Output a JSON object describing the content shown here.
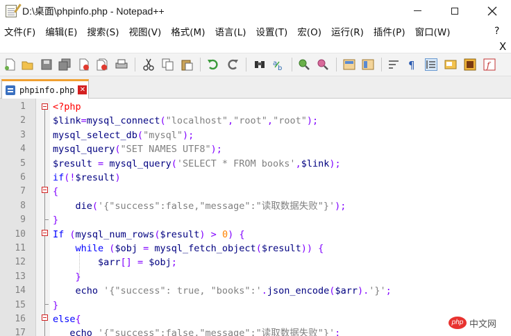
{
  "window": {
    "title": "D:\\桌面\\phpinfo.php - Notepad++"
  },
  "menu": {
    "items": [
      "文件(F)",
      "编辑(E)",
      "搜索(S)",
      "视图(V)",
      "格式(M)",
      "语言(L)",
      "设置(T)",
      "宏(O)",
      "运行(R)",
      "插件(P)",
      "窗口(W)"
    ],
    "help": "?",
    "doc_close": "X"
  },
  "toolbar": {
    "icons": [
      "new-file-icon",
      "open-file-icon",
      "save-icon",
      "save-all-icon",
      "close-file-icon",
      "close-all-icon",
      "print-icon",
      "cut-icon",
      "copy-icon",
      "paste-icon",
      "undo-icon",
      "redo-icon",
      "find-icon",
      "replace-icon",
      "zoom-in-icon",
      "zoom-out-icon",
      "sync-vertical-icon",
      "sync-horizontal-icon",
      "word-wrap-icon",
      "show-all-chars-icon",
      "indent-guide-icon",
      "user-lang-icon",
      "doc-map-icon",
      "function-list-icon"
    ]
  },
  "tab": {
    "label": "phpinfo.php"
  },
  "editor": {
    "line_numbers": [
      "1",
      "2",
      "3",
      "4",
      "5",
      "6",
      "7",
      "8",
      "9",
      "10",
      "11",
      "12",
      "13",
      "14",
      "15",
      "16",
      "17"
    ],
    "lines": [
      [
        [
          "php",
          "<?php"
        ]
      ],
      [
        [
          "var",
          "$link"
        ],
        [
          "op",
          "="
        ],
        [
          "fn",
          "mysql_connect"
        ],
        [
          "op",
          "("
        ],
        [
          "str",
          "\"localhost\""
        ],
        [
          "op",
          ","
        ],
        [
          "str",
          "\"root\""
        ],
        [
          "op",
          ","
        ],
        [
          "str",
          "\"root\""
        ],
        [
          "op",
          ");"
        ]
      ],
      [
        [
          "fn",
          "mysql_select_db"
        ],
        [
          "op",
          "("
        ],
        [
          "str",
          "\"mysql\""
        ],
        [
          "op",
          ");"
        ]
      ],
      [
        [
          "fn",
          "mysql_query"
        ],
        [
          "op",
          "("
        ],
        [
          "str",
          "\"SET NAMES UTF8\""
        ],
        [
          "op",
          ");"
        ]
      ],
      [
        [
          "var",
          "$result"
        ],
        [
          "pl",
          " "
        ],
        [
          "op",
          "="
        ],
        [
          "pl",
          " "
        ],
        [
          "fn",
          "mysql_query"
        ],
        [
          "op",
          "("
        ],
        [
          "str",
          "'SELECT * FROM books'"
        ],
        [
          "op",
          ","
        ],
        [
          "var",
          "$link"
        ],
        [
          "op",
          ");"
        ]
      ],
      [
        [
          "kw",
          "if"
        ],
        [
          "op",
          "(!"
        ],
        [
          "var",
          "$result"
        ],
        [
          "op",
          ")"
        ]
      ],
      [
        [
          "op",
          "{"
        ]
      ],
      [
        [
          "pl",
          "    "
        ],
        [
          "fn",
          "die"
        ],
        [
          "op",
          "("
        ],
        [
          "str",
          "'{\"success\":false,\"message\":\"读取数据失败\"}'"
        ],
        [
          "op",
          ");"
        ]
      ],
      [
        [
          "op",
          "}"
        ]
      ],
      [
        [
          "kw",
          "If"
        ],
        [
          "pl",
          " "
        ],
        [
          "op",
          "("
        ],
        [
          "fn",
          "mysql_num_rows"
        ],
        [
          "op",
          "("
        ],
        [
          "var",
          "$result"
        ],
        [
          "op",
          ")"
        ],
        [
          "pl",
          " "
        ],
        [
          "op",
          ">"
        ],
        [
          "pl",
          " "
        ],
        [
          "num",
          "0"
        ],
        [
          "op",
          ")"
        ],
        [
          "pl",
          " "
        ],
        [
          "op",
          "{"
        ]
      ],
      [
        [
          "pl",
          "    "
        ],
        [
          "kw",
          "while"
        ],
        [
          "pl",
          " "
        ],
        [
          "op",
          "("
        ],
        [
          "var",
          "$obj"
        ],
        [
          "pl",
          " "
        ],
        [
          "op",
          "="
        ],
        [
          "pl",
          " "
        ],
        [
          "fn",
          "mysql_fetch_object"
        ],
        [
          "op",
          "("
        ],
        [
          "var",
          "$result"
        ],
        [
          "op",
          "))"
        ],
        [
          "pl",
          " "
        ],
        [
          "op",
          "{"
        ]
      ],
      [
        [
          "pl",
          "        "
        ],
        [
          "var",
          "$arr"
        ],
        [
          "op",
          "[]"
        ],
        [
          "pl",
          " "
        ],
        [
          "op",
          "="
        ],
        [
          "pl",
          " "
        ],
        [
          "var",
          "$obj"
        ],
        [
          "op",
          ";"
        ]
      ],
      [
        [
          "pl",
          "    "
        ],
        [
          "op",
          "}"
        ]
      ],
      [
        [
          "pl",
          "    "
        ],
        [
          "fn",
          "echo"
        ],
        [
          "pl",
          " "
        ],
        [
          "str",
          "'{\"success\": true, \"books\":'"
        ],
        [
          "op",
          "."
        ],
        [
          "fn",
          "json_encode"
        ],
        [
          "op",
          "("
        ],
        [
          "var",
          "$arr"
        ],
        [
          "op",
          ")."
        ],
        [
          "str",
          "'}'"
        ],
        [
          "op",
          ";"
        ]
      ],
      [
        [
          "op",
          "}"
        ]
      ],
      [
        [
          "kw",
          "else"
        ],
        [
          "op",
          "{"
        ]
      ],
      [
        [
          "pl",
          "   "
        ],
        [
          "fn",
          "echo"
        ],
        [
          "pl",
          " "
        ],
        [
          "str",
          "'{\"success\":false,\"message\":\"读取数据失败\"}'"
        ],
        [
          "op",
          ";"
        ]
      ]
    ]
  },
  "watermark": {
    "badge": "php",
    "text": "中文网"
  }
}
